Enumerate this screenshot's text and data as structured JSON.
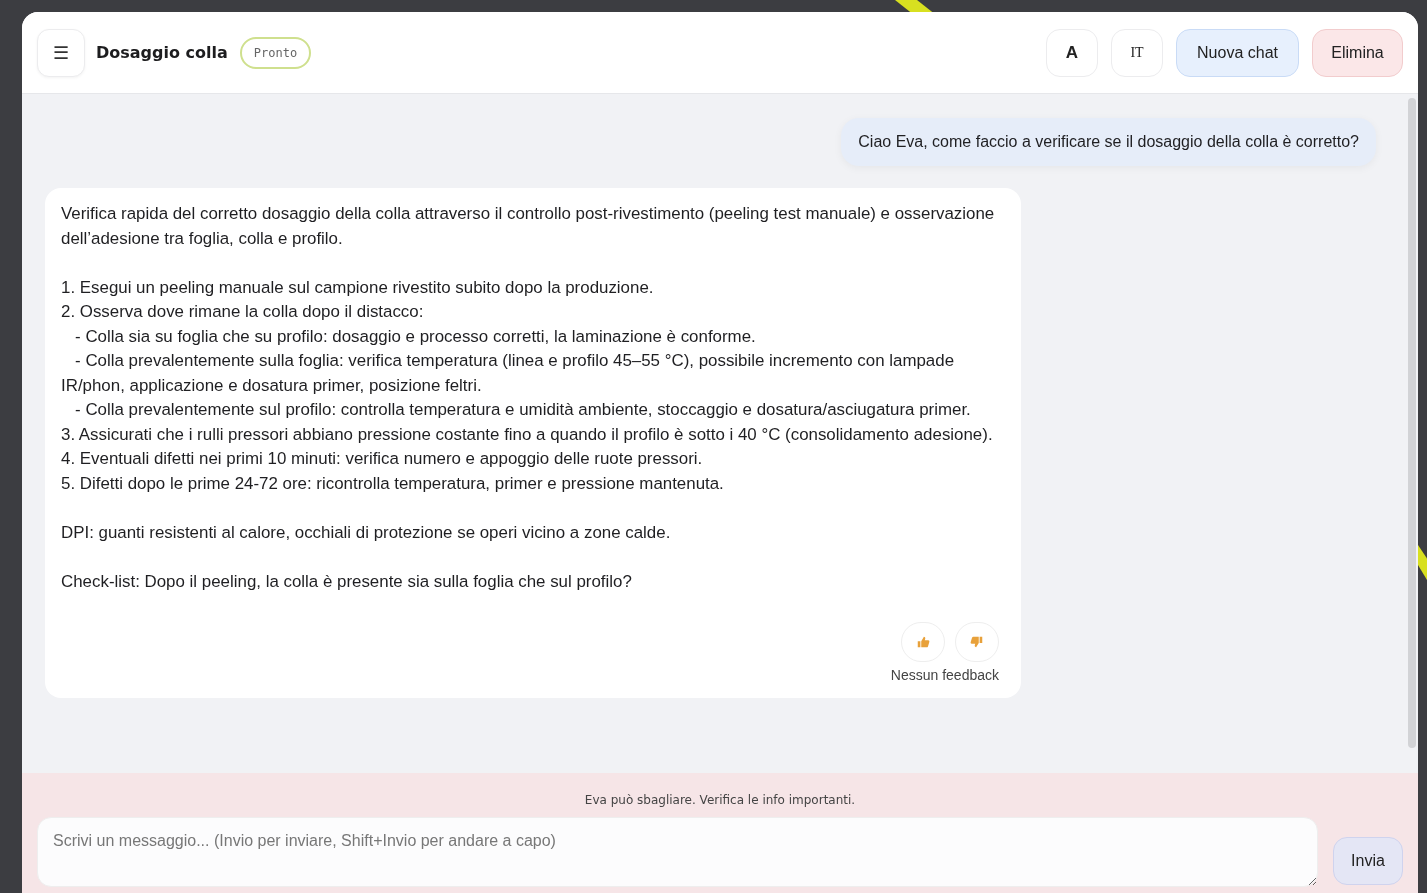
{
  "header": {
    "menu_icon": "☰",
    "title": "Dosaggio colla",
    "status": "Pronto",
    "buttons": [
      {
        "label": "A",
        "kind": "font"
      },
      {
        "label": "IT",
        "kind": "lang"
      },
      {
        "label": "Nuova chat",
        "kind": "primary"
      },
      {
        "label": "Elimina",
        "kind": "danger"
      }
    ]
  },
  "messages": [
    {
      "kind": "user",
      "paragraphs": [
        [
          "Ciao Eva, come faccio a verificare se il dosaggio della colla è corretto?"
        ]
      ]
    },
    {
      "kind": "assistant",
      "paragraphs": [
        [
          "Verifica rapida del corretto dosaggio della colla attraverso il controllo post-rivestimento (peeling test manuale) e osservazione dell’adesione tra foglia, colla e profilo."
        ],
        [
          "1. Esegui un peeling manuale sul campione rivestito subito dopo la produzione.",
          "2. Osserva dove rimane la colla dopo il distacco:",
          "   - Colla sia su foglia che su profilo: dosaggio e processo corretti, la laminazione è conforme.",
          "   - Colla prevalentemente sulla foglia: verifica temperatura (linea e profilo 45–55 °C), possibile incremento con lampade IR/phon, applicazione e dosatura primer, posizione feltri.",
          "   - Colla prevalentemente sul profilo: controlla temperatura e umidità ambiente, stoccaggio e dosatura/asciugatura primer.",
          "3. Assicurati che i rulli pressori abbiano pressione costante fino a quando il profilo è sotto i 40 °C (consolidamento adesione).",
          "4. Eventuali difetti nei primi 10 minuti: verifica numero e appoggio delle ruote pressori.",
          "5. Difetti dopo le prime 24-72 ore: ricontrolla temperatura, primer e pressione mantenuta."
        ],
        [
          "DPI: guanti resistenti al calore, occhiali di protezione se operi vicino a zone calde."
        ],
        [
          "Check-list: Dopo il peeling, la colla è presente sia sulla foglia che sul profilo?"
        ]
      ],
      "feedback": {
        "status": "Nessun feedback",
        "thumbs_up": false,
        "thumbs_down": false
      }
    }
  ],
  "footer": {
    "disclaimer": "Eva può sbagliare. Verifica le info importanti.",
    "input": {
      "placeholder": "Scrivi un messaggio... (Invio per inviare, Shift+Invio per andare a capo)"
    },
    "send": "Invia"
  }
}
